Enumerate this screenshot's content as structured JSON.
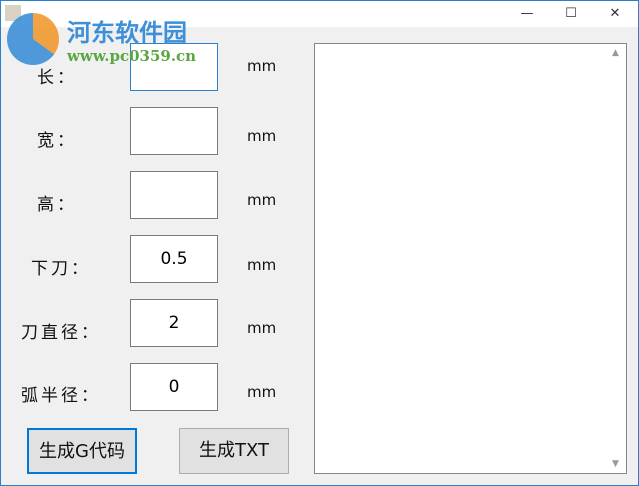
{
  "window": {
    "minimize": "—",
    "maximize": "☐",
    "close": "✕"
  },
  "watermark": {
    "title": "河东软件园",
    "url": "www.pc0359.cn"
  },
  "fields": [
    {
      "label": "长：",
      "value": "",
      "unit": "mm"
    },
    {
      "label": "宽：",
      "value": "",
      "unit": "mm"
    },
    {
      "label": "高：",
      "value": "",
      "unit": "mm"
    },
    {
      "label": "下刀：",
      "value": "0.5",
      "unit": "mm"
    },
    {
      "label": "刀直径：",
      "value": "2",
      "unit": "mm"
    },
    {
      "label": "弧半径：",
      "value": "0",
      "unit": "mm"
    }
  ],
  "buttons": {
    "gcode": "生成G代码",
    "txt": "生成TXT"
  },
  "scroll": {
    "up": "▲",
    "down": "▼"
  }
}
